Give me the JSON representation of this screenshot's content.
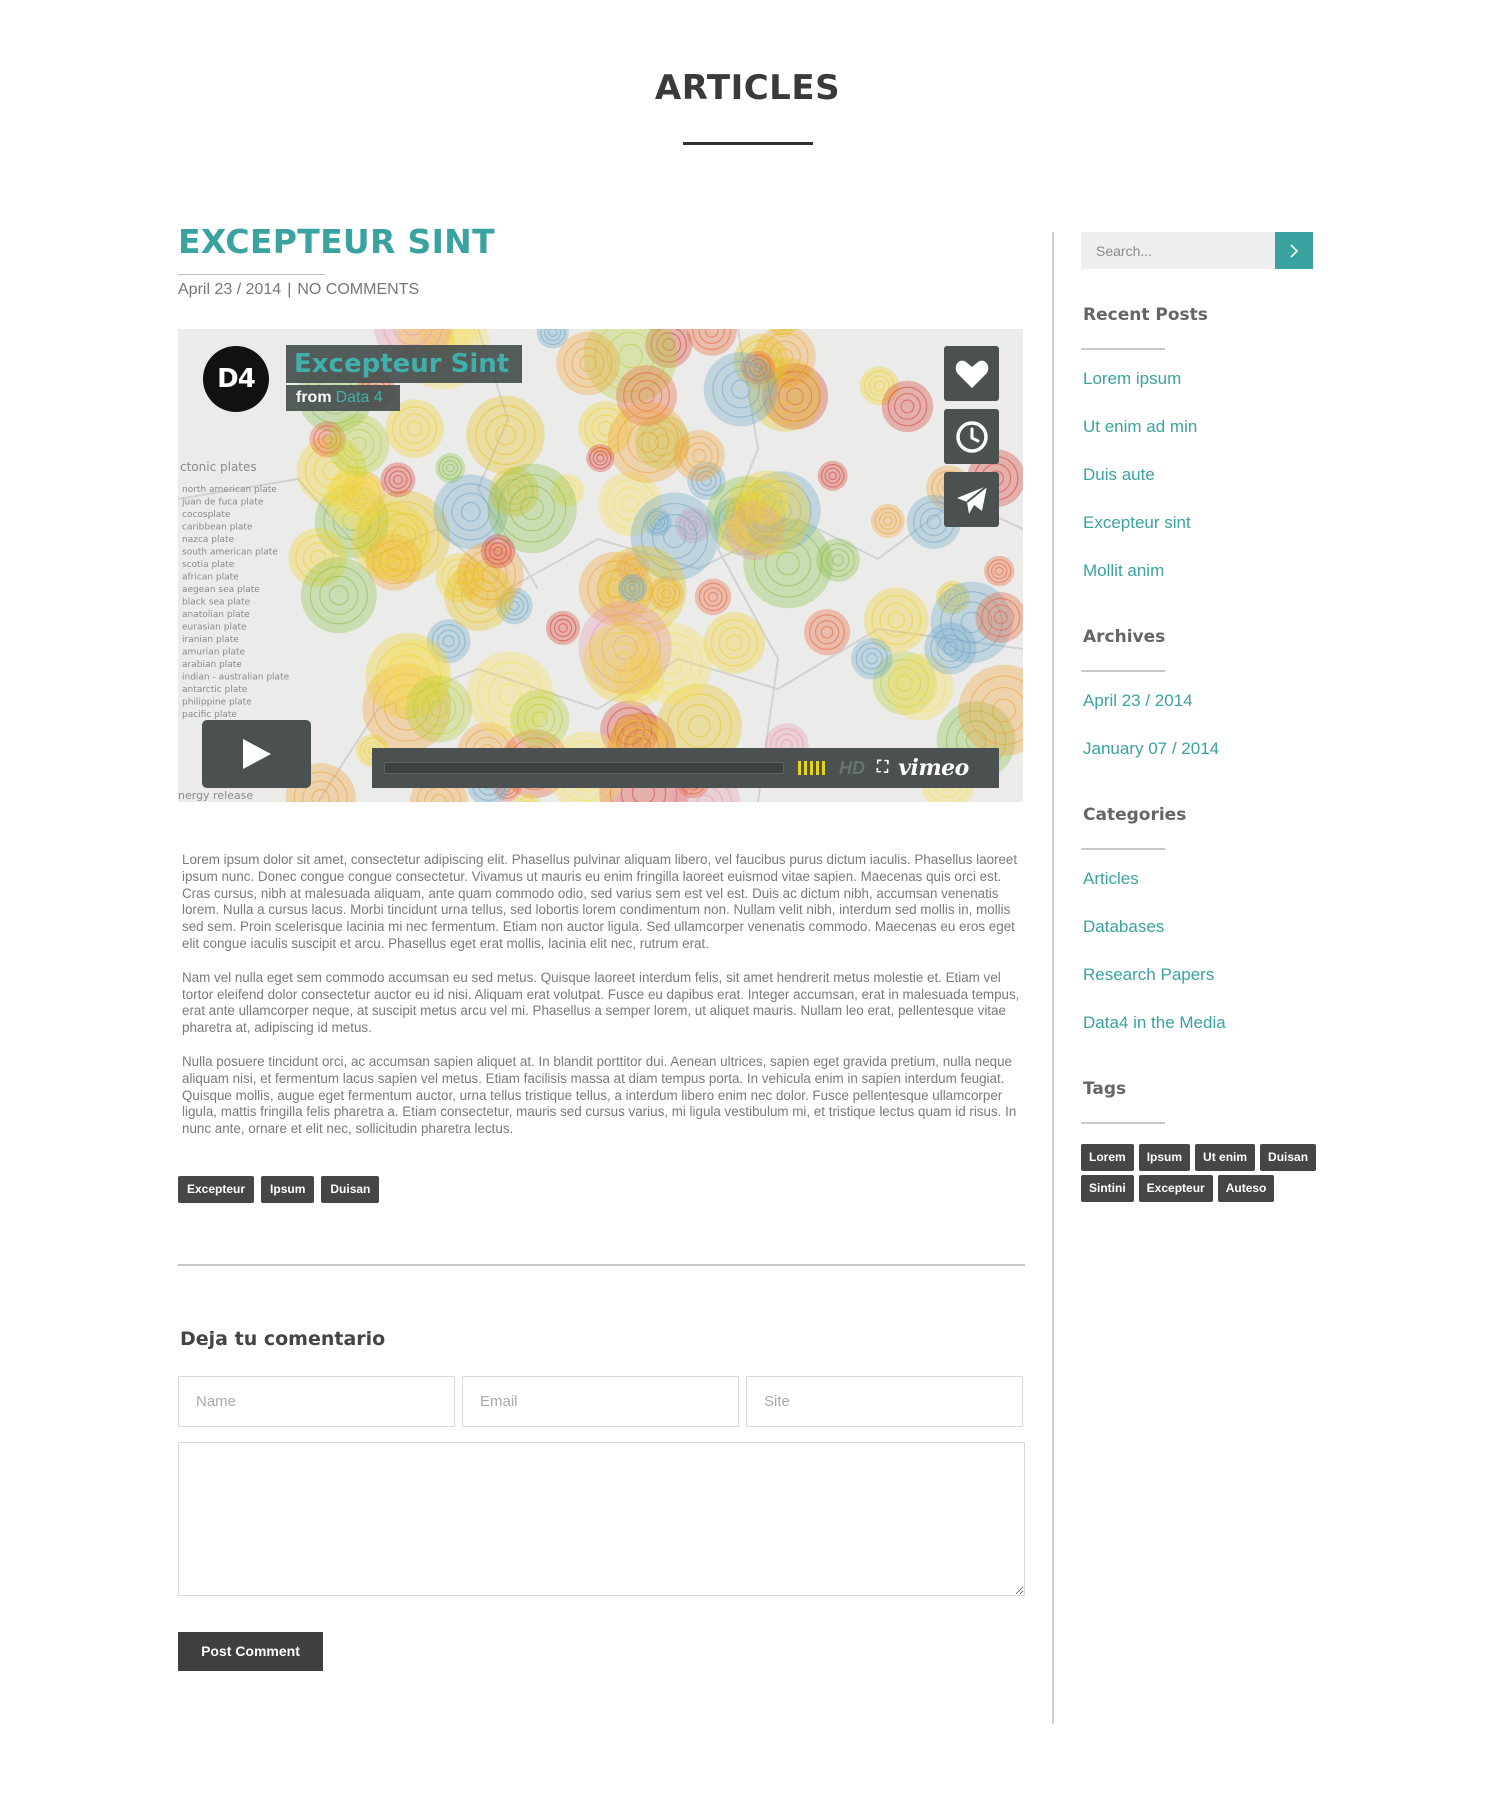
{
  "page": {
    "title": "ARTICLES"
  },
  "post": {
    "title": "EXCEPTEUR SINT",
    "date": "April 23 / 2014",
    "separator": "|",
    "comments": "NO COMMENTS",
    "paragraphs": [
      "Lorem ipsum dolor sit amet, consectetur adipiscing elit. Phasellus pulvinar aliquam libero, vel faucibus purus dictum iaculis. Phasellus laoreet ipsum nunc. Donec congue congue consectetur. Vivamus ut mauris eu enim fringilla laoreet euismod vitae sapien. Maecenas quis orci est. Cras cursus, nibh at malesuada aliquam, ante quam commodo odio, sed varius sem est vel est. Duis ac dictum nibh, accumsan venenatis lorem. Nulla a cursus lacus. Morbi tincidunt urna tellus, sed lobortis lorem condimentum non. Nullam velit nibh, interdum sed mollis in, mollis sed sem. Proin scelerisque lacinia mi nec fermentum. Etiam non auctor ligula. Sed ullamcorper venenatis commodo. Maecenas eu eros eget elit congue iaculis suscipit et arcu. Phasellus eget erat mollis, lacinia elit nec, rutrum erat.",
      "Nam vel nulla eget sem commodo accumsan eu sed metus. Quisque laoreet interdum felis, sit amet hendrerit metus molestie et. Etiam vel tortor eleifend dolor consectetur auctor eu id nisi. Aliquam erat volutpat. Fusce eu dapibus erat. Integer accumsan, erat in malesuada tempus, erat ante ullamcorper neque, at suscipit metus arcu vel mi. Phasellus a semper lorem, ut aliquet mauris. Nullam leo erat, pellentesque vitae pharetra at, adipiscing id metus.",
      "Nulla posuere tincidunt orci, ac accumsan sapien aliquet at. In blandit porttitor dui. Aenean ultrices, sapien eget gravida pretium, nulla neque aliquam nisi, et fermentum lacus sapien vel metus. Etiam facilisis massa at diam tempus porta. In vehicula enim in sapien interdum feugiat. Quisque mollis, augue eget fermentum auctor, urna tellus tristique tellus, a interdum libero enim nec dolor. Fusce pellentesque ullamcorper ligula, mattis fringilla felis pharetra a. Etiam consectetur, mauris sed cursus varius, mi ligula vestibulum mi, et tristique lectus quam id risus. In nunc ante, ornare et elit nec, sollicitudin pharetra lectus."
    ],
    "tags": [
      "Excepteur",
      "Ipsum",
      "Duisan"
    ]
  },
  "video": {
    "logo": "D4",
    "title": "Excepteur Sint",
    "from_label": "from",
    "from_source": "Data 4",
    "hd_label": "HD",
    "brand": "vimeo",
    "map_legend_title": "ctonic plates",
    "map_legend_items": [
      "north american plate",
      "juan de fuca plate",
      "cocosplate",
      "caribbean plate",
      "nazca plate",
      "south american plate",
      "scotia plate",
      "african plate",
      "aegean sea plate",
      "black sea plate",
      "anatolian plate",
      "eurasian plate",
      "iranian plate",
      "amurian plate",
      "arabian plate",
      "indian - australian plate",
      "antarctic plate",
      "philippine plate",
      "pacific plate"
    ],
    "map_footer": "nergy release",
    "accent_color": "#3fb0ac",
    "volume_color": "#e4d617"
  },
  "comment_form": {
    "heading": "Deja tu comentario",
    "name_placeholder": "Name",
    "email_placeholder": "Email",
    "site_placeholder": "Site",
    "submit_label": "Post Comment"
  },
  "sidebar": {
    "search_placeholder": "Search...",
    "recent_posts": {
      "title": "Recent Posts",
      "items": [
        "Lorem ipsum",
        "Ut enim ad min",
        "Duis aute",
        "Excepteur sint",
        "Mollit anim"
      ]
    },
    "archives": {
      "title": "Archives",
      "items": [
        "April 23 / 2014",
        "January 07 / 2014"
      ]
    },
    "categories": {
      "title": "Categories",
      "items": [
        "Articles",
        "Databases",
        "Research Papers",
        "Data4 in the Media"
      ]
    },
    "tags": {
      "title": "Tags",
      "items": [
        "Lorem",
        "Ipsum",
        "Ut enim",
        "Duisan",
        "Sintini",
        "Excepteur",
        "Auteso"
      ]
    }
  },
  "colors": {
    "accent": "#3aa3a0",
    "dark": "#464646",
    "title": "#3a3a3a"
  }
}
